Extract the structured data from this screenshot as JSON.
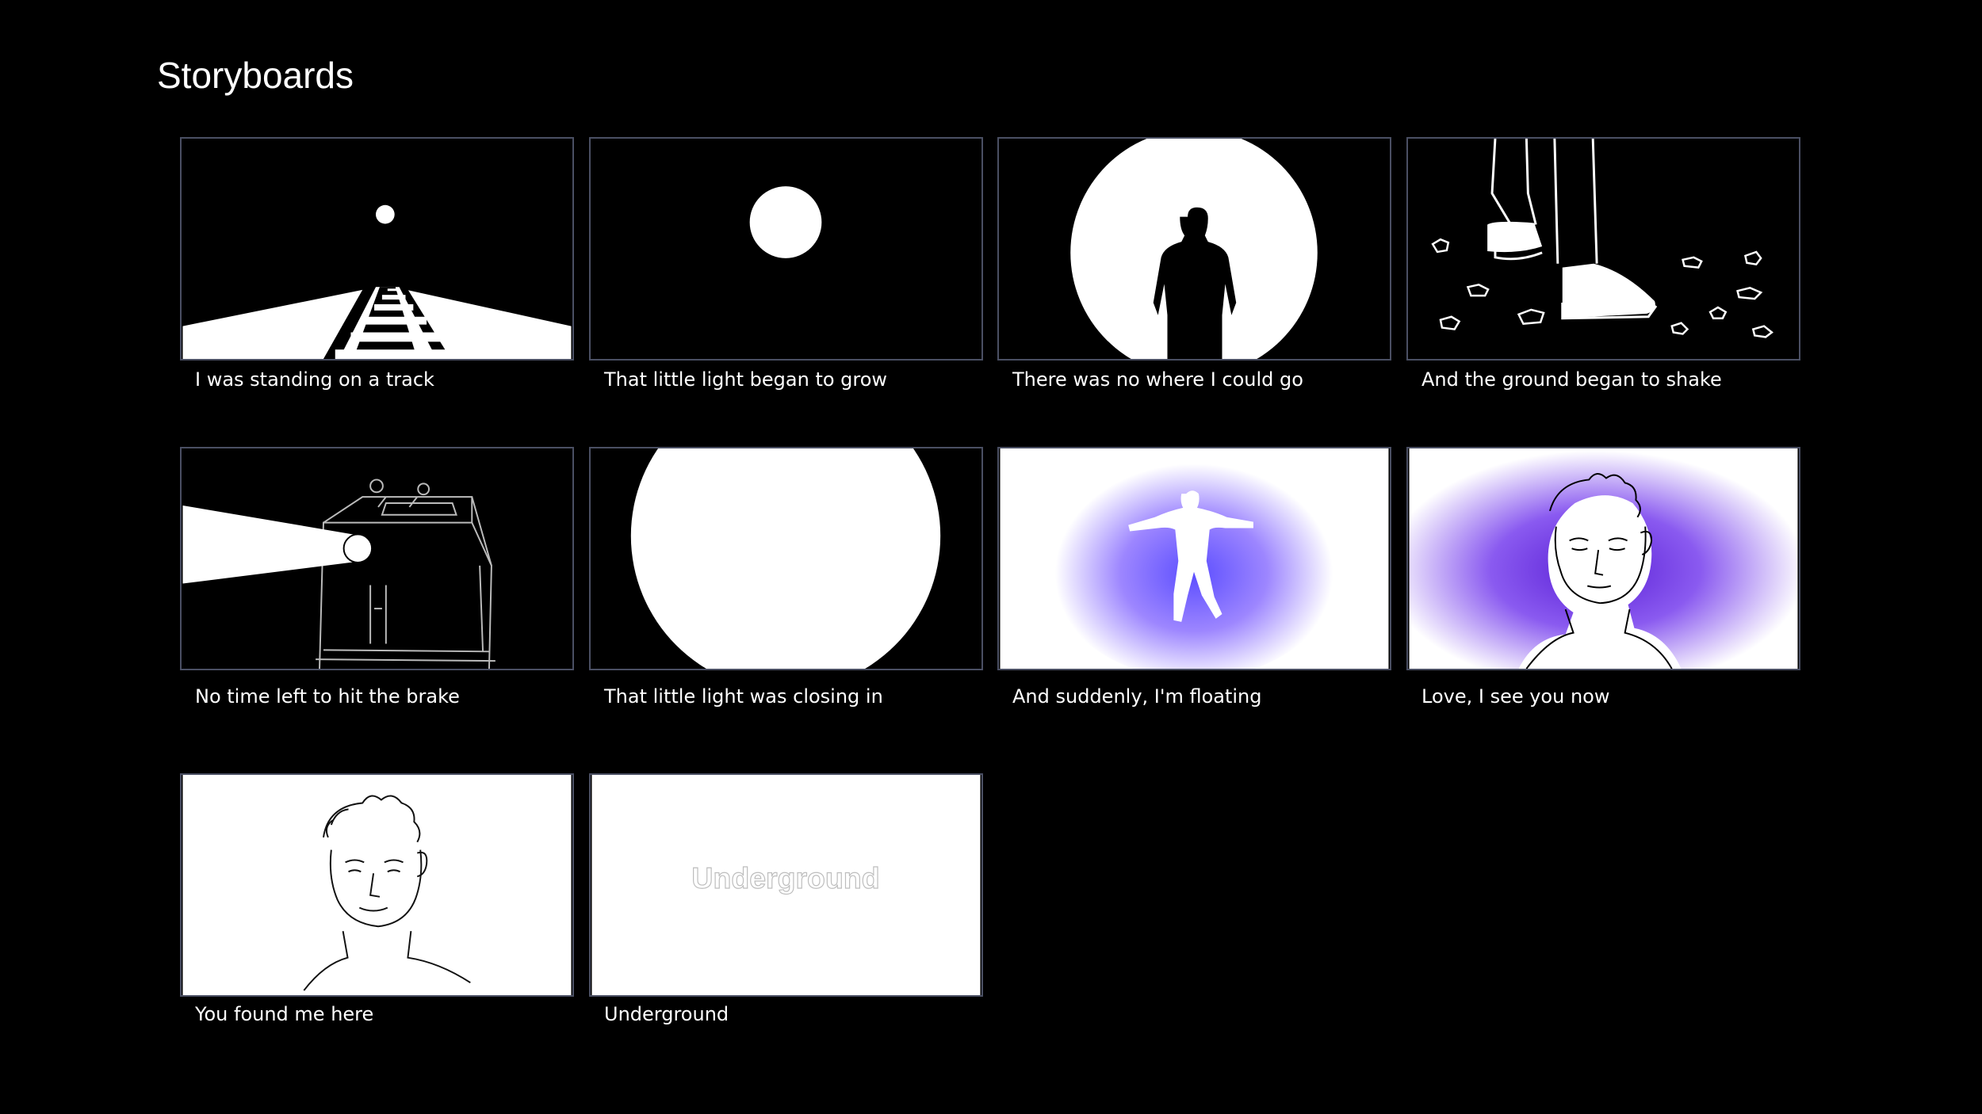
{
  "page": {
    "title": "Storyboards"
  },
  "panels": [
    {
      "caption": "I was standing on a track"
    },
    {
      "caption": "That little light began to grow"
    },
    {
      "caption": "There was no where I could go"
    },
    {
      "caption": "And the ground began to shake"
    },
    {
      "caption": "No time left to hit the brake"
    },
    {
      "caption": "That little light was closing in"
    },
    {
      "caption": "And suddenly, I'm floating"
    },
    {
      "caption": "Love, I see you now"
    },
    {
      "caption": "You found me here"
    },
    {
      "caption": "Underground",
      "title_card_text": "Underground"
    }
  ],
  "colors": {
    "background": "#000000",
    "panel_border": "#4a4f63",
    "glow": "#7b4dff"
  }
}
